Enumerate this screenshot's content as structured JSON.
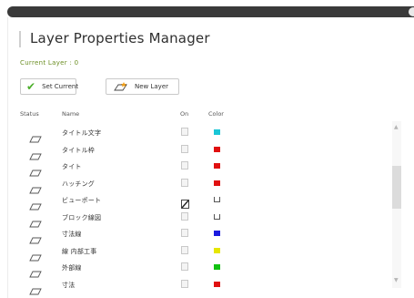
{
  "window": {
    "title": "Layer Properties Manager"
  },
  "current_layer": {
    "label": "Current Layer : 0"
  },
  "toolbar": {
    "set_current_label": "Set Current",
    "new_layer_label": "New Layer"
  },
  "table": {
    "headers": {
      "status": "Status",
      "name": "Name",
      "on": "On",
      "color": "Color"
    },
    "rows": [
      {
        "name": "タイトル文字",
        "on": "off",
        "color": "#19c6d6",
        "status_icon": "layer-icon"
      },
      {
        "name": "タイトル枠",
        "on": "off",
        "color": "#e01010",
        "status_icon": "layer-icon"
      },
      {
        "name": "タイト",
        "on": "off",
        "color": "#e01010",
        "status_icon": "layer-icon"
      },
      {
        "name": "ハッチング",
        "on": "off",
        "color": "#e01010",
        "status_icon": "layer-icon"
      },
      {
        "name": "ビューポート",
        "on": "frozen",
        "color": "#ffffff",
        "status_icon": "layer-icon"
      },
      {
        "name": "ブロック線図",
        "on": "off",
        "color": "#ffffff",
        "status_icon": "layer-icon"
      },
      {
        "name": "寸法線",
        "on": "off",
        "color": "#1a1adf",
        "status_icon": "layer-icon"
      },
      {
        "name": "線 内部工事",
        "on": "off",
        "color": "#e6e600",
        "status_icon": "layer-icon"
      },
      {
        "name": "外部線",
        "on": "off",
        "color": "#12c212",
        "status_icon": "layer-icon"
      },
      {
        "name": "寸法",
        "on": "off",
        "color": "#e01010",
        "status_icon": "layer-icon"
      }
    ]
  }
}
